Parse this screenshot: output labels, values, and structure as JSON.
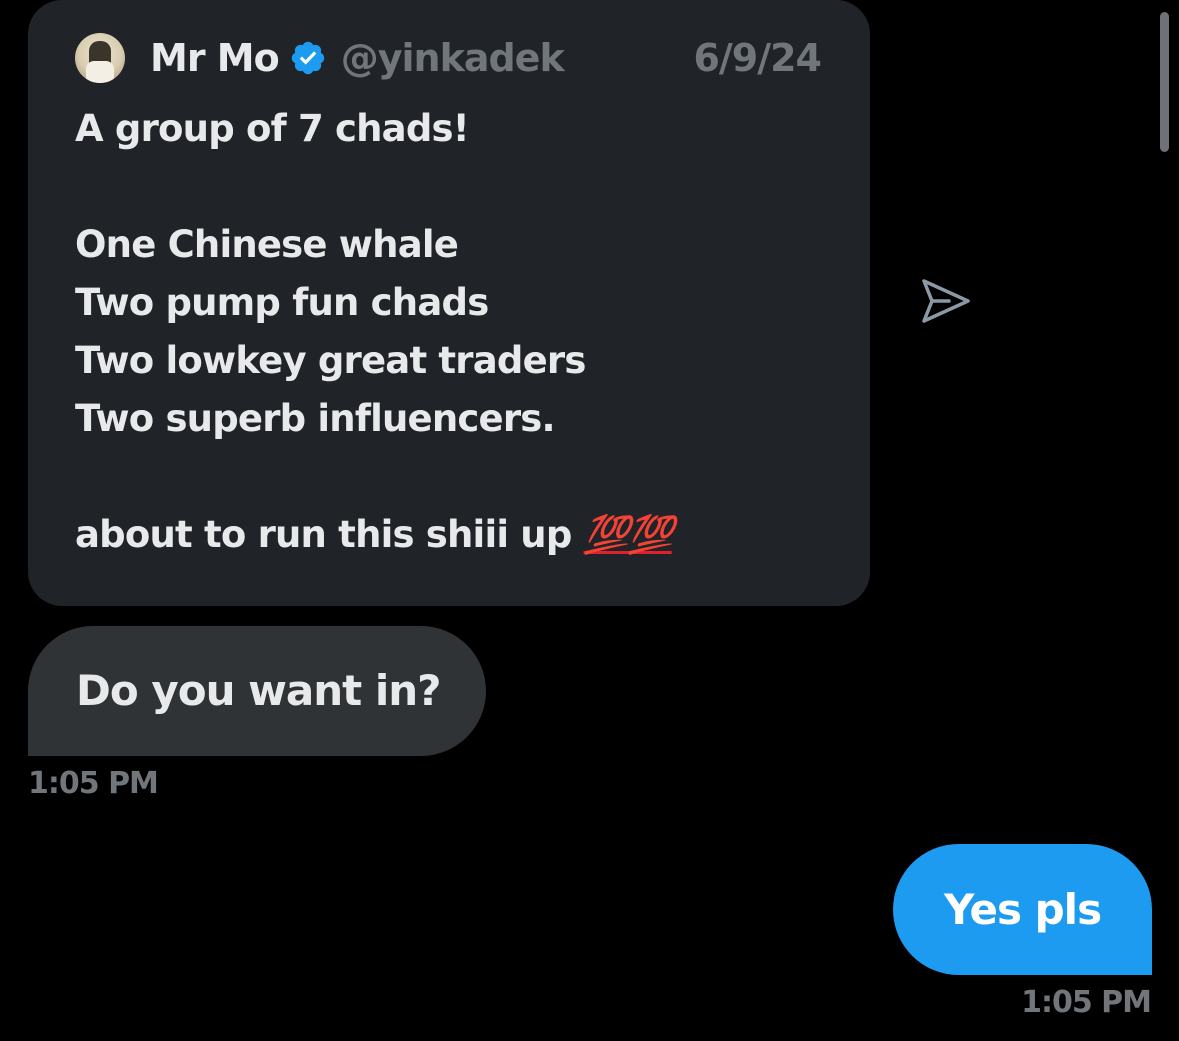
{
  "quoted_tweet": {
    "display_name": "Mr Mo",
    "handle": "@yinkadek",
    "date": "6/9/24",
    "verified": true,
    "avatar_icon": "profile-avatar",
    "lines": [
      "A group of 7 chads!",
      "",
      "One Chinese whale",
      "Two pump fun chads",
      "Two lowkey great traders",
      "Two superb influencers.",
      ""
    ],
    "last_line_text": "about to run this shiii up",
    "last_line_emoji": "💯💯"
  },
  "share_icon": "send-icon",
  "messages": [
    {
      "direction": "received",
      "text": "Do you want in?",
      "time": "1:05 PM"
    },
    {
      "direction": "sent",
      "text": "Yes pls",
      "time": "1:05 PM"
    }
  ],
  "colors": {
    "background": "#000000",
    "card": "#202327",
    "received_bubble": "#2f3336",
    "sent_bubble": "#1d9bf0",
    "verified_badge": "#1d9bf0",
    "muted_text": "#71767b",
    "primary_text": "#e7e9ea"
  }
}
